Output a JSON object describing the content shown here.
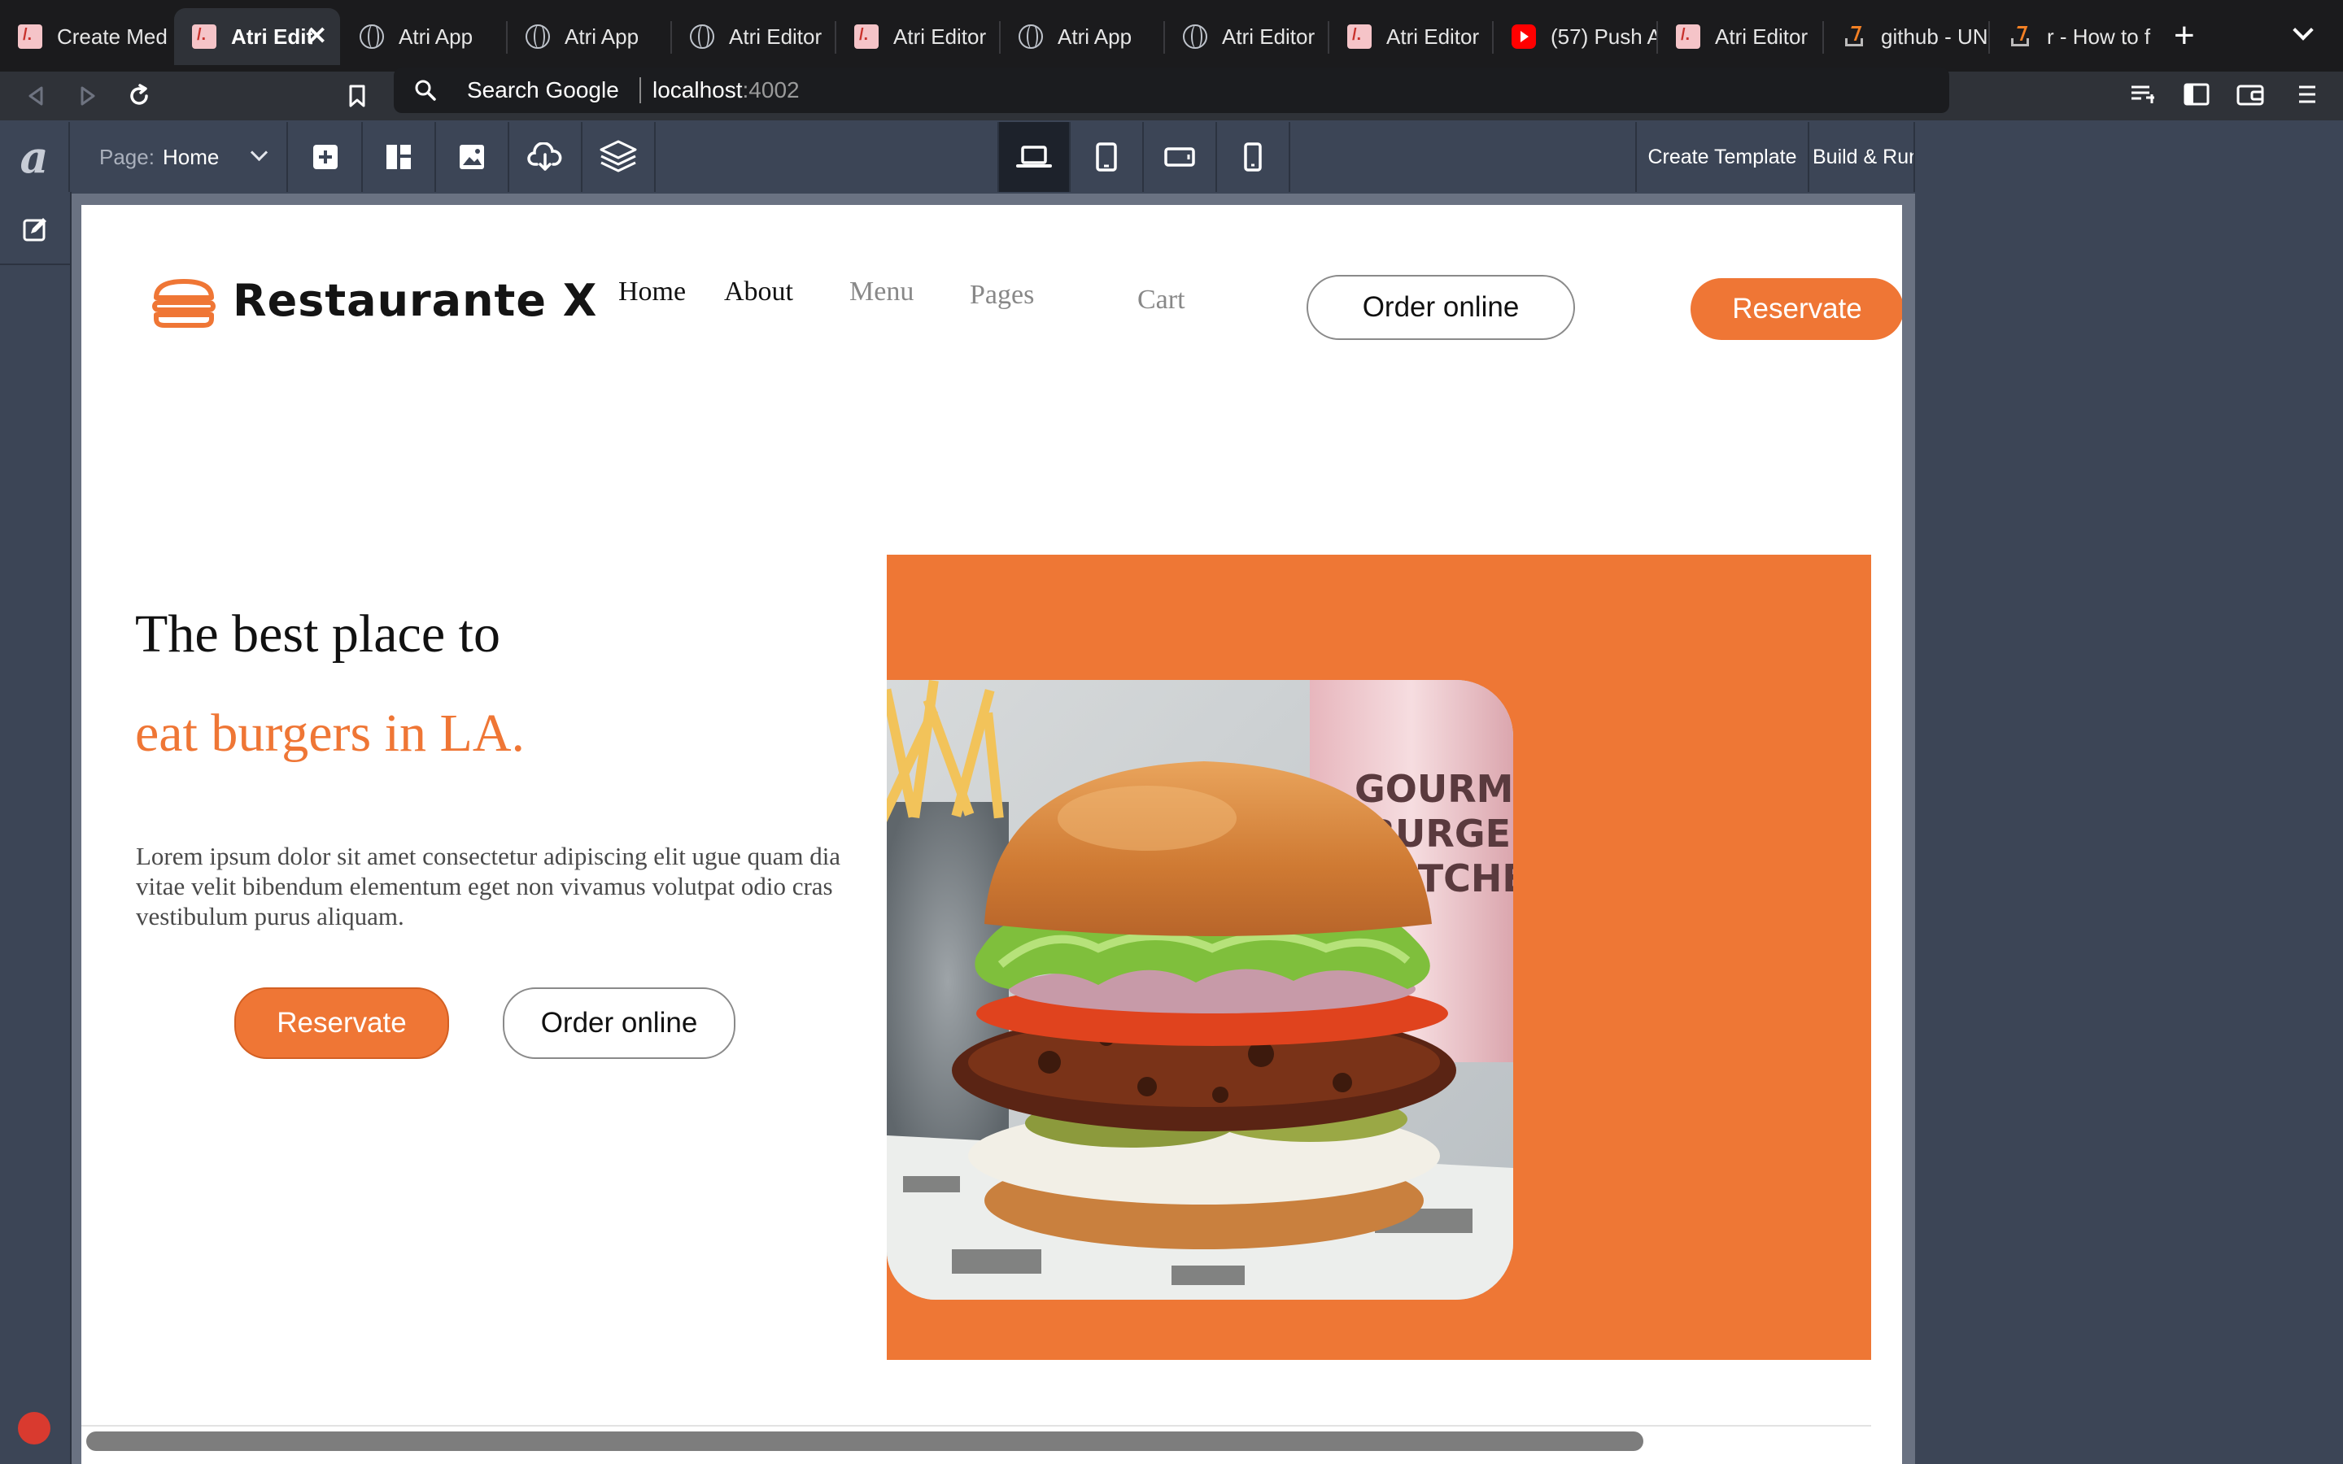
{
  "browser": {
    "tabs": [
      {
        "label": "Create Med",
        "favicon": "atri-icon",
        "active": false
      },
      {
        "label": "Atri Edit",
        "favicon": "atri-icon",
        "active": true
      },
      {
        "label": "Atri App",
        "favicon": "globe-icon",
        "active": false
      },
      {
        "label": "Atri App",
        "favicon": "globe-icon",
        "active": false
      },
      {
        "label": "Atri Editor",
        "favicon": "globe-icon",
        "active": false
      },
      {
        "label": "Atri Editor",
        "favicon": "atri-icon",
        "active": false
      },
      {
        "label": "Atri App",
        "favicon": "globe-icon",
        "active": false
      },
      {
        "label": "Atri Editor",
        "favicon": "globe-icon",
        "active": false
      },
      {
        "label": "Atri Editor",
        "favicon": "atri-icon",
        "active": false
      },
      {
        "label": "(57) Push A",
        "favicon": "youtube-icon",
        "active": false
      },
      {
        "label": "Atri Editor",
        "favicon": "atri-icon",
        "active": false
      },
      {
        "label": "github - UN",
        "favicon": "stackoverflow-icon",
        "active": false
      },
      {
        "label": "r - How to f",
        "favicon": "stackoverflow-icon",
        "active": false
      }
    ],
    "new_tab": "+",
    "close_glyph": "✕",
    "address": {
      "search_label": "Search Google",
      "host": "localhost",
      "port": ":4002"
    }
  },
  "editor": {
    "logo": "a",
    "page_select": {
      "label": "Page:",
      "value": "Home"
    },
    "buttons": [
      "add-component-icon",
      "layout-icon",
      "image-icon",
      "cloud-download-icon",
      "layers-icon"
    ],
    "devices": [
      "laptop-icon",
      "tablet-icon",
      "tablet-landscape-icon",
      "phone-icon"
    ],
    "active_device": "laptop-icon",
    "create_template": "Create Template",
    "build_run": "Build & Run"
  },
  "site": {
    "brand": "Restaurante X",
    "nav": [
      "Home",
      "About",
      "Menu",
      "Pages",
      "Cart"
    ],
    "header_order": "Order online",
    "header_reserve": "Reservate",
    "hero": {
      "line1": "The best place to",
      "line2": "eat burgers in LA.",
      "body": [
        "Lorem ipsum dolor sit amet consectetur adipiscing elit ugue quam dia",
        "vitae velit bibendum elementum eget non vivamus volutpat odio cras",
        "vestibulum purus aliquam."
      ],
      "reserve": "Reservate",
      "order": "Order online"
    },
    "photo_text": [
      "GOURMET",
      "BURGER",
      "KITCHEN"
    ]
  },
  "colors": {
    "accent": "#ef7635",
    "editor_bg": "#3c4556",
    "tab_bg": "#1b1b1d"
  }
}
